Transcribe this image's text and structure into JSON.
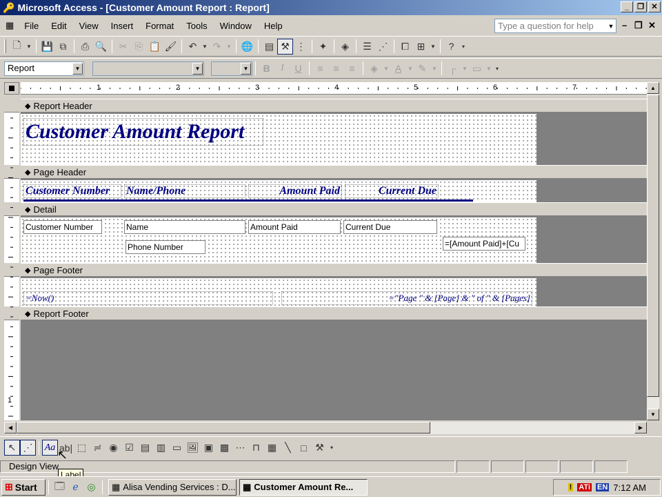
{
  "window": {
    "title": "Microsoft Access - [Customer Amount Report : Report]",
    "minimize": "_",
    "restore": "❐",
    "close": "✕"
  },
  "menu": {
    "items": [
      "File",
      "Edit",
      "View",
      "Insert",
      "Format",
      "Tools",
      "Window",
      "Help"
    ],
    "ask_placeholder": "Type a question for help"
  },
  "formatting": {
    "object_combo": "Report",
    "font_combo": "",
    "size_combo": ""
  },
  "sections": {
    "report_header": "Report Header",
    "page_header": "Page Header",
    "detail": "Detail",
    "page_footer": "Page Footer",
    "report_footer": "Report Footer"
  },
  "report_header": {
    "title": "Customer Amount Report"
  },
  "page_header": {
    "labels": [
      "Customer Number",
      "Name/Phone",
      "Amount Paid",
      "Current Due"
    ]
  },
  "detail": {
    "customer_number": "Customer Number",
    "name": "Name",
    "amount_paid": "Amount Paid",
    "current_due": "Current Due",
    "phone_number": "Phone Number",
    "total_expr": "=[Amount Paid]+[Cu"
  },
  "page_footer": {
    "date_expr": "=Now()",
    "page_expr": "=\"Page \" & [Page] & \" of \" & [Pages]"
  },
  "ruler": {
    "numbers": [
      "1",
      "2",
      "3",
      "4",
      "5",
      "6",
      "7"
    ],
    "v_numbers": [
      "1"
    ]
  },
  "status": {
    "text": "Design View",
    "tooltip": "Label"
  },
  "taskbar": {
    "start": "Start",
    "tasks": [
      "Alisa Vending Services : D...",
      "Customer Amount Re..."
    ],
    "lang": "EN",
    "clock": "7:12 AM"
  }
}
